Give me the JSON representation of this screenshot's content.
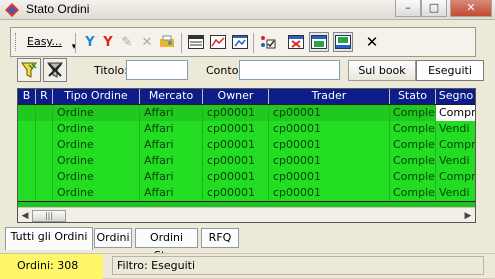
{
  "window": {
    "title": "Stato Ordini",
    "controls": [
      "–",
      "□",
      "✕"
    ]
  },
  "toolbar": {
    "easy_label": "Easy...",
    "icons": [
      "filter-icon",
      "filter-red-icon",
      "edit-icon",
      "delete-icon",
      "print-icon",
      "grid-view-icon",
      "chart-icon",
      "chart-window-icon",
      "checklist-icon",
      "cross-window-icon",
      "layout-icon",
      "layout-active-icon",
      "close-icon"
    ]
  },
  "filters": {
    "titolo_label": "Titolo:",
    "titolo_value": "",
    "conto_label": "Conto:",
    "conto_value": "",
    "sul_book_label": "Sul book",
    "eseguiti_label": "Eseguiti"
  },
  "grid": {
    "columns": [
      "B",
      "R",
      "Tipo Ordine",
      "Mercato",
      "Owner",
      "Trader",
      "Stato",
      "Segno"
    ],
    "rows": [
      [
        "",
        "",
        "Ordine",
        "Affari",
        "cp00001",
        "cp00001",
        "Complete",
        "Compra"
      ],
      [
        "",
        "",
        "Ordine",
        "Affari",
        "cp00001",
        "cp00001",
        "Complete",
        "Vendi"
      ],
      [
        "",
        "",
        "Ordine",
        "Affari",
        "cp00001",
        "cp00001",
        "Complete",
        "Compra"
      ],
      [
        "",
        "",
        "Ordine",
        "Affari",
        "cp00001",
        "cp00001",
        "Complete",
        "Vendi"
      ],
      [
        "",
        "",
        "Ordine",
        "Affari",
        "cp00001",
        "cp00001",
        "Complete",
        "Compra"
      ],
      [
        "",
        "",
        "Ordine",
        "Affari",
        "cp00001",
        "cp00001",
        "Complete",
        "Vendi"
      ]
    ]
  },
  "tabs": [
    "Tutti gli Ordini",
    "Ordini",
    "Ordini Stop",
    "RFQ"
  ],
  "status": {
    "count": "Ordini: 308",
    "filter": "Filtro: Eseguiti"
  },
  "colors": {
    "header_bg": "#0c1c88",
    "row_bg": "#22dd22",
    "status_highlight": "#fff66a"
  }
}
